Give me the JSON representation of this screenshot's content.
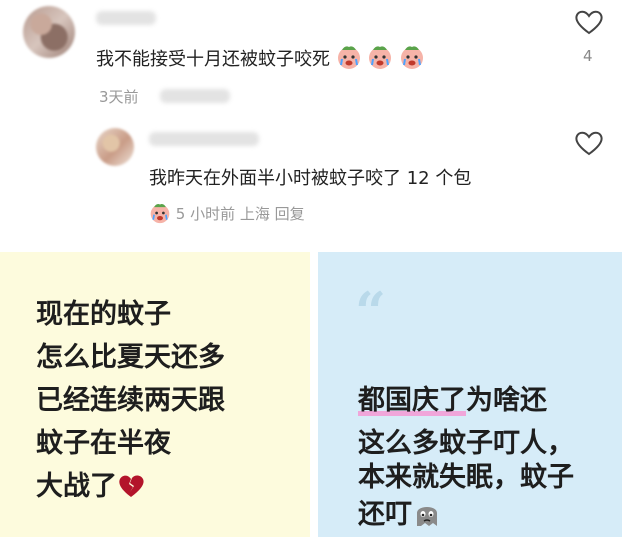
{
  "comment": {
    "text": "我不能接受十月还被蚊子咬死",
    "emoji": "crying-face-emoji",
    "time": "3天前",
    "like_count": "4"
  },
  "reply": {
    "text": "我昨天在外面半小时被蚊子咬了 12 个包",
    "meta_time": "5 小时前",
    "meta_location": "上海",
    "meta_reply": "回复"
  },
  "cards": {
    "left": {
      "lines": [
        "现在的蚊子",
        "怎么比夏天还多",
        "已经连续两天跟",
        "蚊子在半夜",
        "大战了"
      ],
      "emoji": "broken-heart-emoji"
    },
    "right": {
      "quote": "“",
      "line1_highlight": "都国庆了",
      "line1_rest": "为啥还",
      "lines": [
        "这么多蚊子叮人，",
        "本来就失眠，蚊子",
        "还叮"
      ],
      "emoji": "sad-ghost-emoji"
    }
  },
  "colors": {
    "left_card_bg": "#fdfbdd",
    "right_card_bg": "#d6ecf8",
    "highlight": "#f0a6da"
  }
}
